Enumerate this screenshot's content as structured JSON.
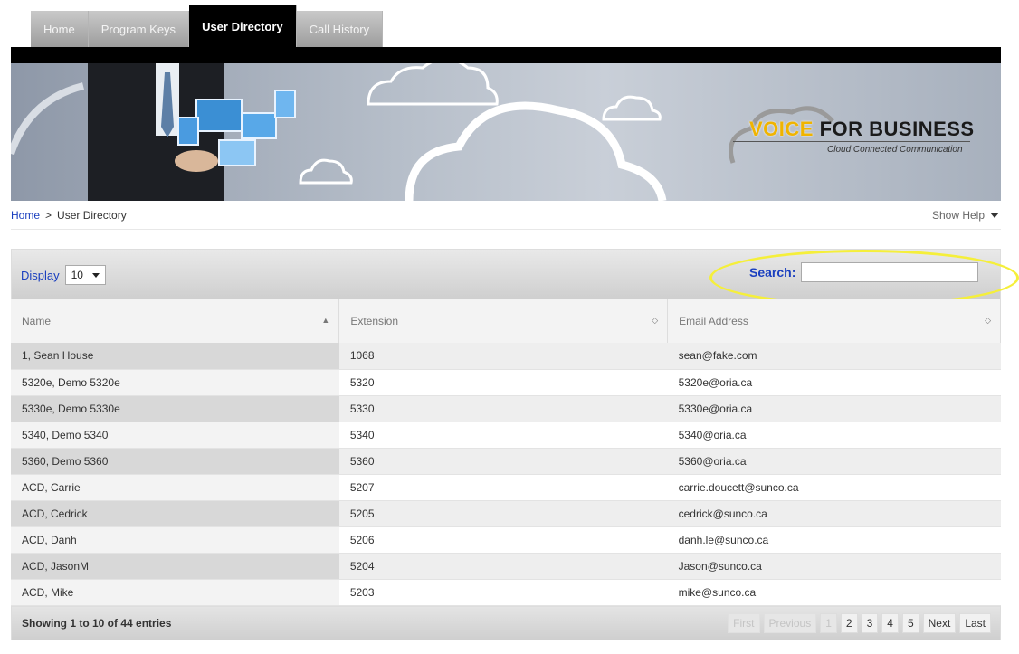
{
  "tabs": [
    {
      "label": "Home",
      "active": false
    },
    {
      "label": "Program Keys",
      "active": false
    },
    {
      "label": "User Directory",
      "active": true
    },
    {
      "label": "Call History",
      "active": false
    }
  ],
  "banner": {
    "logo_highlight": "VOICE",
    "logo_rest": " FOR BUSINESS",
    "logo_tagline": "Cloud Connected Communication"
  },
  "breadcrumb": {
    "home": "Home",
    "separator": ">",
    "current": "User Directory"
  },
  "help": {
    "label": "Show Help"
  },
  "toolbar": {
    "display_label": "Display",
    "display_value": "10",
    "search_label": "Search:",
    "search_value": ""
  },
  "table": {
    "headers": [
      "Name",
      "Extension",
      "Email Address"
    ],
    "rows": [
      [
        "1, Sean House",
        "1068",
        "sean@fake.com"
      ],
      [
        "5320e, Demo 5320e",
        "5320",
        "5320e@oria.ca"
      ],
      [
        "5330e, Demo 5330e",
        "5330",
        "5330e@oria.ca"
      ],
      [
        "5340, Demo 5340",
        "5340",
        "5340@oria.ca"
      ],
      [
        "5360, Demo 5360",
        "5360",
        "5360@oria.ca"
      ],
      [
        "ACD, Carrie",
        "5207",
        "carrie.doucett@sunco.ca"
      ],
      [
        "ACD, Cedrick",
        "5205",
        "cedrick@sunco.ca"
      ],
      [
        "ACD, Danh",
        "5206",
        "danh.le@sunco.ca"
      ],
      [
        "ACD, JasonM",
        "5204",
        "Jason@sunco.ca"
      ],
      [
        "ACD, Mike",
        "5203",
        "mike@sunco.ca"
      ]
    ]
  },
  "footer": {
    "showing": "Showing 1 to 10 of 44 entries",
    "pager": [
      "First",
      "Previous",
      "1",
      "2",
      "3",
      "4",
      "5",
      "Next",
      "Last"
    ]
  },
  "colors": {
    "link": "#1a3fbf",
    "highlight_ring": "#f5ef3a",
    "active_tab": "#000000"
  }
}
